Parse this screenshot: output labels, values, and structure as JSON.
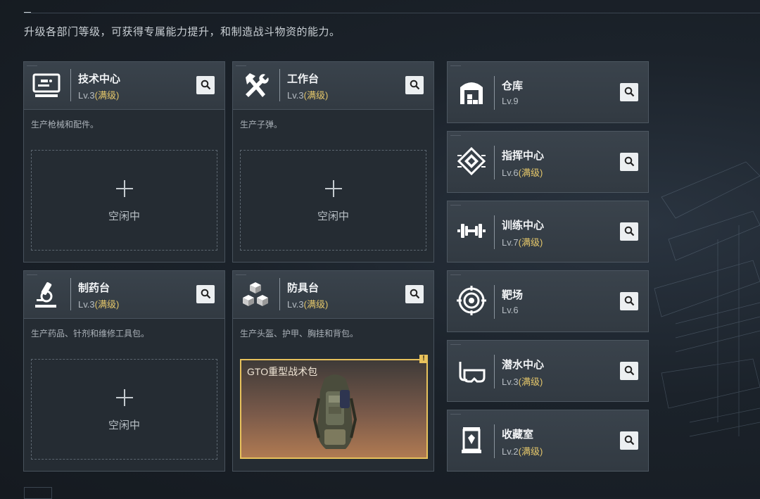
{
  "intro": "升级各部门等级，可获得专属能力提升，和制造战斗物资的能力。",
  "workshops": [
    {
      "name": "技术中心",
      "level": "Lv.3",
      "max": "(满级)",
      "icon": "monitor-icon",
      "desc": "生产枪械和配件。",
      "slot": "空闲中"
    },
    {
      "name": "工作台",
      "level": "Lv.3",
      "max": "(满级)",
      "icon": "tools-icon",
      "desc": "生产子弹。",
      "slot": "空闲中"
    },
    {
      "name": "制药台",
      "level": "Lv.3",
      "max": "(满级)",
      "icon": "microscope-icon",
      "desc": "生产药品、针剂和维修工具包。",
      "slot": "空闲中"
    },
    {
      "name": "防具台",
      "level": "Lv.3",
      "max": "(满级)",
      "icon": "cubes-icon",
      "desc": "生产头盔、护甲、胸挂和背包。",
      "product": "GTO重型战术包",
      "badge": "!"
    }
  ],
  "facilities": [
    {
      "name": "仓库",
      "level": "Lv.9",
      "max": "",
      "icon": "warehouse-icon"
    },
    {
      "name": "指挥中心",
      "level": "Lv.6",
      "max": "(满级)",
      "icon": "command-chip-icon"
    },
    {
      "name": "训练中心",
      "level": "Lv.7",
      "max": "(满级)",
      "icon": "dumbbell-icon"
    },
    {
      "name": "靶场",
      "level": "Lv.6",
      "max": "",
      "icon": "target-icon"
    },
    {
      "name": "潜水中心",
      "level": "Lv.3",
      "max": "(满级)",
      "icon": "dive-mask-icon"
    },
    {
      "name": "收藏室",
      "level": "Lv.2",
      "max": "(满级)",
      "icon": "trophy-case-icon"
    }
  ],
  "colors": {
    "max_level": "#e5c76a",
    "highlight_border": "#e8c25c"
  }
}
